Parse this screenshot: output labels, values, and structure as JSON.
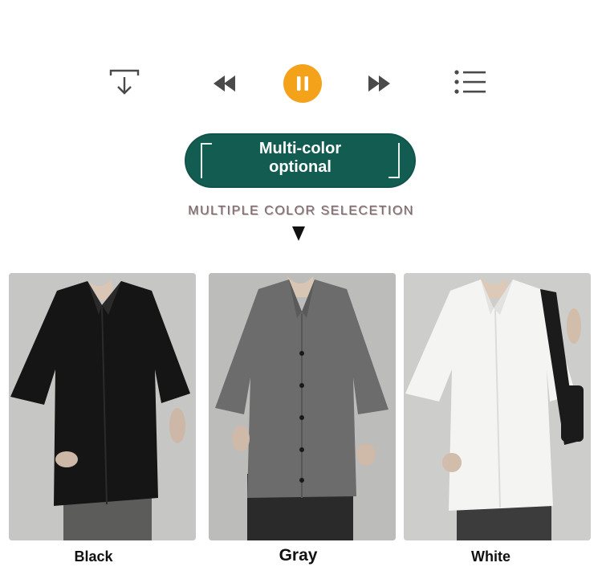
{
  "toolbar": {
    "icons": [
      "download-icon",
      "rewind-icon",
      "pause-icon",
      "fast-forward-icon",
      "playlist-icon"
    ],
    "accent_color": "#f3a21a",
    "icon_color": "#4a4a4a"
  },
  "banner": {
    "line1": "Multi-color",
    "line2": "optional",
    "color": "#135c52"
  },
  "subtitle": "MULTIPLE COLOR SELECETION",
  "products": [
    {
      "label": "Black",
      "shirt_color": "#151515"
    },
    {
      "label": "Gray",
      "shirt_color": "#6c6c6c"
    },
    {
      "label": "White",
      "shirt_color": "#f2f2f0"
    }
  ]
}
